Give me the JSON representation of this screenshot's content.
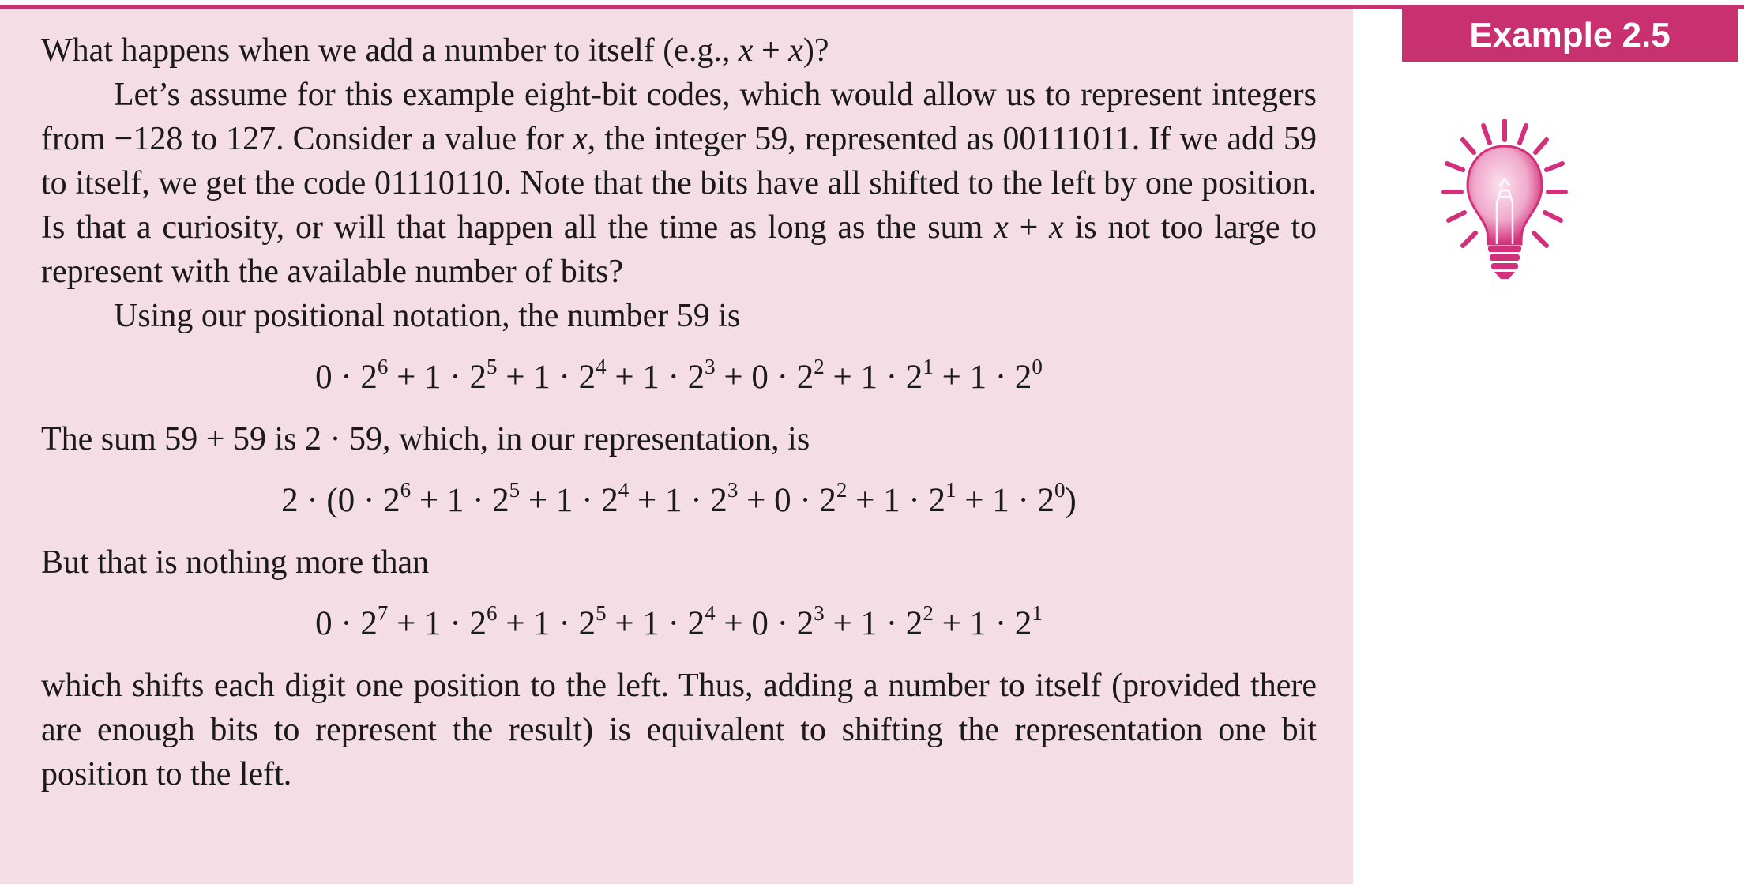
{
  "badge": {
    "label": "Example 2.5"
  },
  "icon": {
    "name": "lightbulb-icon",
    "color": "#d2307a"
  },
  "colors": {
    "accent": "#c8306f",
    "panel_background": "#f4dde4"
  },
  "body": {
    "p1": "What happens when we add a number to itself (e.g., x + x)?",
    "p2": "Let’s assume for this example eight-bit codes, which would allow us to represent integers from −128 to 127. Consider a value for x, the integer 59, represented as 00111011. If we add 59 to itself, we get the code 01110110. Note that the bits have all shifted to the left by one position. Is that a curiosity, or will that happen all the time as long as the sum x + x is not too large to represent with the available number of bits?",
    "p3": "Using our positional notation, the number 59 is",
    "eq1": "0 · 2⁶ + 1 · 2⁵ + 1 · 2⁴ + 1 · 2³ + 0 · 2² + 1 · 2¹ + 1 · 2⁰",
    "p4": "The sum 59 + 59 is 2 · 59, which, in our representation, is",
    "eq2": "2 · (0 · 2⁶ + 1 · 2⁵ + 1 · 2⁴ + 1 · 2³ + 0 · 2² + 1 · 2¹ + 1 · 2⁰)",
    "p5": "But that is nothing more than",
    "eq3": "0 · 2⁷ + 1 · 2⁶ + 1 · 2⁵ + 1 · 2⁴ + 0 · 2³ + 1 · 2² + 1 · 2¹",
    "p6": "which shifts each digit one position to the left. Thus, adding a number to itself (provided there are enough bits to represent the result) is equivalent to shifting the representation one bit position to the left."
  }
}
